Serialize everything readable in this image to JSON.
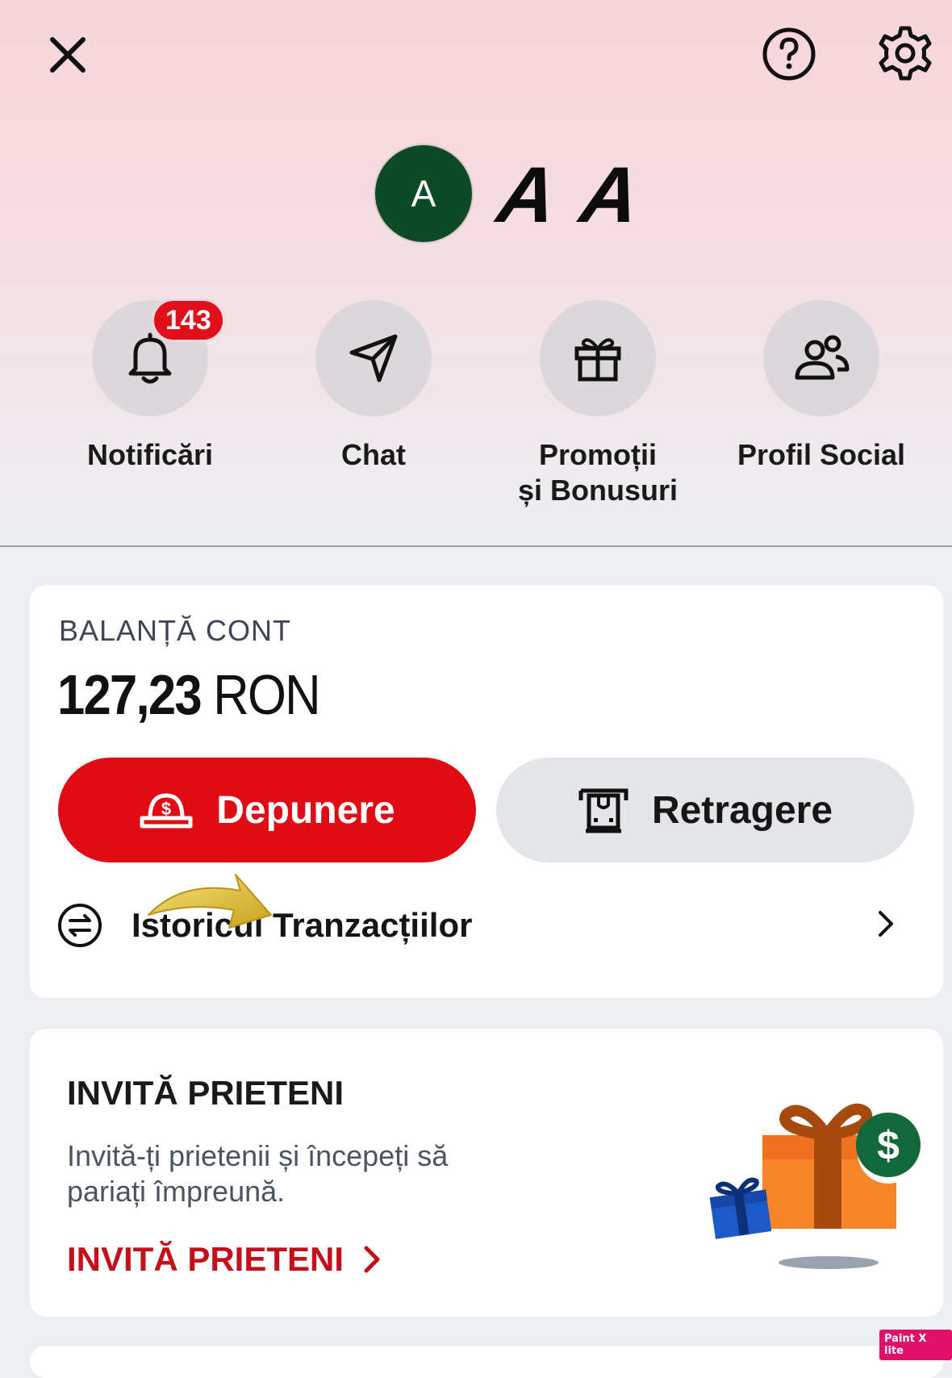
{
  "header": {
    "avatar_initial": "A",
    "username": "A A",
    "quick_actions": [
      {
        "label": "Notificări",
        "icon": "bell-icon",
        "badge": "143"
      },
      {
        "label": "Chat",
        "icon": "send-icon"
      },
      {
        "label_line1": "Promoții",
        "label_line2": "și Bonusuri",
        "icon": "gift-icon"
      },
      {
        "label": "Profil Social",
        "icon": "people-icon"
      }
    ]
  },
  "balance": {
    "label": "BALANȚĂ CONT",
    "amount": "127,23",
    "currency": "RON",
    "deposit_label": "Depunere",
    "withdraw_label": "Retragere",
    "history_label": "Istoricul Tranzacțiilor"
  },
  "invite": {
    "title": "INVITĂ PRIETENI",
    "description": "Invită-ți prietenii și începeți să pariați împreună.",
    "link": "INVITĂ PRIETENI"
  },
  "watermark": "Paint X lite",
  "colors": {
    "accent_red": "#df0b15",
    "avatar_green": "#0f4a26"
  }
}
